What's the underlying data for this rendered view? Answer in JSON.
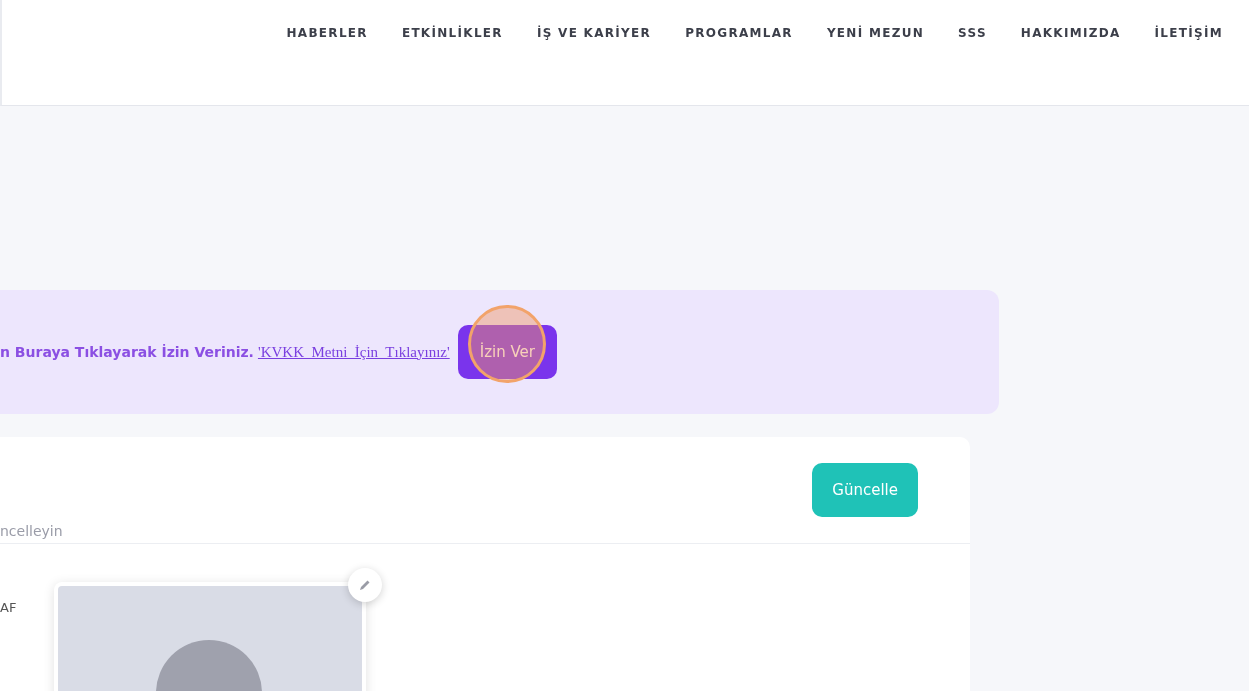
{
  "nav": {
    "items": [
      {
        "label": "HABERLER"
      },
      {
        "label": "ETKİNLİKLER"
      },
      {
        "label": "İŞ VE KARİYER"
      },
      {
        "label": "PROGRAMLAR"
      },
      {
        "label": "YENİ MEZUN"
      },
      {
        "label": "SSS"
      },
      {
        "label": "HAKKIMIZDA"
      },
      {
        "label": "İLETİŞİM"
      }
    ]
  },
  "consent": {
    "text": "n Buraya Tıklayarak İzin Veriniz.",
    "link": "'KVKK  Metni  İçin  Tıklayınız'",
    "button": "İzin Ver"
  },
  "profile": {
    "subtitle": "ncelleyin",
    "button": "Güncelle",
    "field_label": "AF"
  }
}
